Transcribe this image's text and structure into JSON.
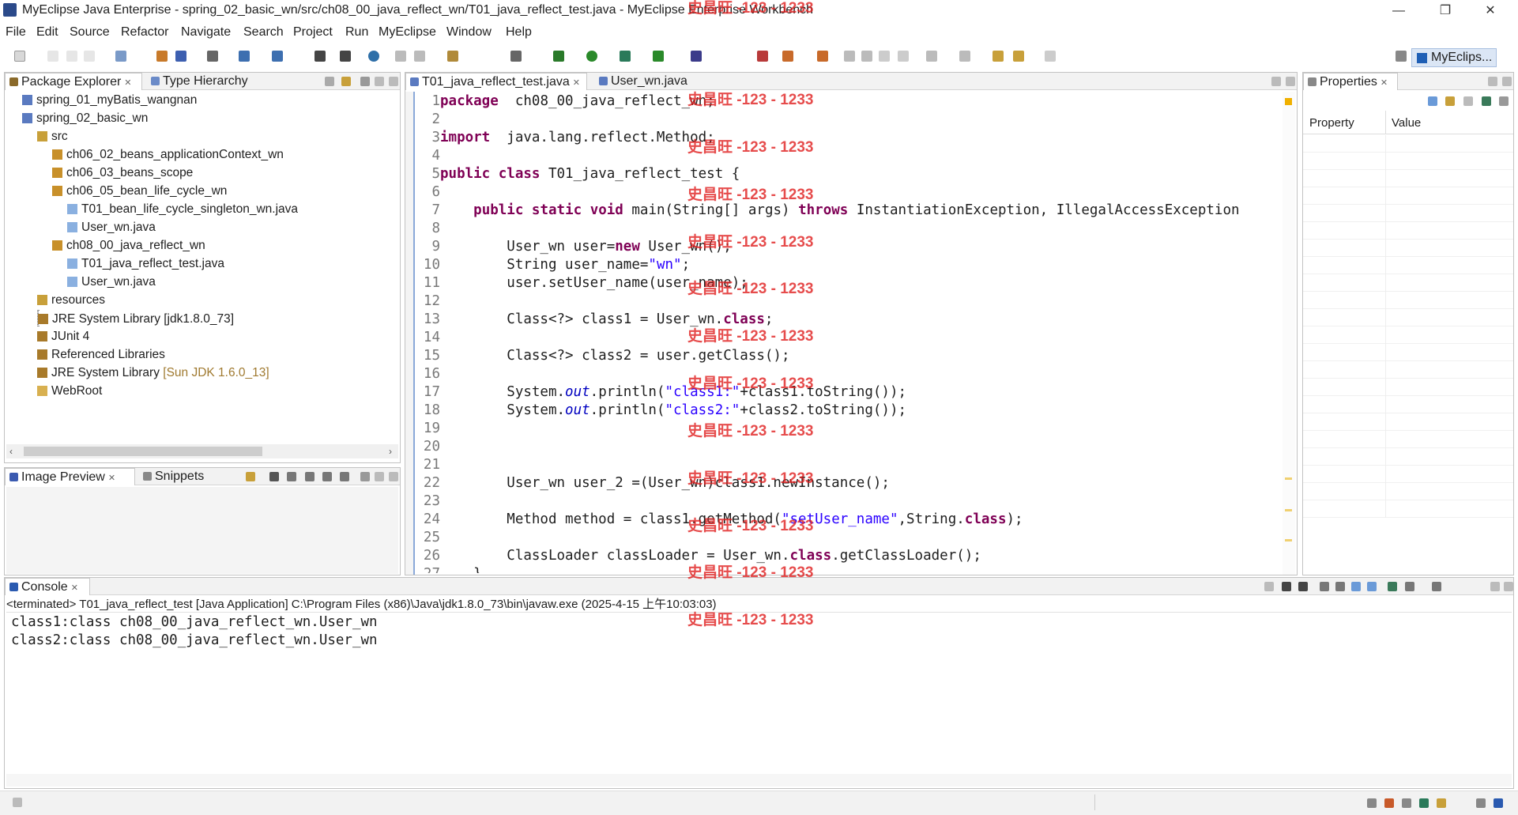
{
  "window": {
    "title": "MyEclipse Java Enterprise - spring_02_basic_wn/src/ch08_00_java_reflect_wn/T01_java_reflect_test.java - MyEclipse Enterprise Workbench",
    "minimize": "—",
    "restore": "❐",
    "close": "✕"
  },
  "menu": [
    "File",
    "Edit",
    "Source",
    "Refactor",
    "Navigate",
    "Search",
    "Project",
    "Run",
    "MyEclipse",
    "Window",
    "Help"
  ],
  "perspective": "MyEclips...",
  "package_explorer": {
    "tab": "Package Explorer",
    "tab2": "Type Hierarchy",
    "items": [
      {
        "label": "spring_01_myBatis_wangnan",
        "suffix": "",
        "icon": "project-icon",
        "indent": 0
      },
      {
        "label": "spring_02_basic_wn",
        "suffix": "",
        "icon": "project-icon",
        "indent": 0
      },
      {
        "label": "src",
        "suffix": "",
        "icon": "source-folder-icon",
        "indent": 1
      },
      {
        "label": "ch06_02_beans_applicationContext_wn",
        "suffix": "",
        "icon": "package-icon",
        "indent": 2
      },
      {
        "label": "ch06_03_beans_scope",
        "suffix": "",
        "icon": "package-icon",
        "indent": 2
      },
      {
        "label": "ch06_05_bean_life_cycle_wn",
        "suffix": "",
        "icon": "package-icon",
        "indent": 2
      },
      {
        "label": "T01_bean_life_cycle_singleton_wn.java",
        "suffix": "",
        "icon": "java-file-icon",
        "indent": 3
      },
      {
        "label": "User_wn.java",
        "suffix": "",
        "icon": "java-file-icon",
        "indent": 3
      },
      {
        "label": "ch08_00_java_reflect_wn",
        "suffix": "",
        "icon": "package-icon",
        "indent": 2
      },
      {
        "label": "T01_java_reflect_test.java",
        "suffix": "",
        "icon": "java-file-icon",
        "indent": 3
      },
      {
        "label": "User_wn.java",
        "suffix": "",
        "icon": "java-file-icon",
        "indent": 3
      },
      {
        "label": "resources",
        "suffix": "",
        "icon": "source-folder-icon",
        "indent": 1
      },
      {
        "label": "JRE System Library [jdk1.8.0_73]",
        "suffix": "",
        "icon": "library-icon",
        "indent": 1
      },
      {
        "label": "JUnit 4",
        "suffix": "",
        "icon": "library-icon",
        "indent": 1
      },
      {
        "label": "Referenced Libraries",
        "suffix": "",
        "icon": "library-icon",
        "indent": 1
      },
      {
        "label": "JRE System Library",
        "suffix": " [Sun JDK 1.6.0_13]",
        "icon": "library-icon",
        "indent": 1
      },
      {
        "label": "WebRoot",
        "suffix": "",
        "icon": "folder-icon",
        "indent": 1
      }
    ]
  },
  "image_preview": {
    "tab": "Image Preview",
    "tab2": "Snippets"
  },
  "editor": {
    "tabs": [
      "T01_java_reflect_test.java",
      "User_wn.java"
    ],
    "lines": [
      [
        [
          "kw",
          "package"
        ],
        [
          "",
          "  ch08_00_java_reflect_wn;"
        ]
      ],
      [],
      [
        [
          "kw",
          "import"
        ],
        [
          "",
          "  java.lang.reflect.Method;"
        ]
      ],
      [],
      [
        [
          "kw",
          "public"
        ],
        [
          "",
          " "
        ],
        [
          "kw",
          "class"
        ],
        [
          "",
          " T01_java_reflect_test {"
        ]
      ],
      [],
      [
        [
          "",
          "    "
        ],
        [
          "kw",
          "public"
        ],
        [
          "",
          " "
        ],
        [
          "kw",
          "static"
        ],
        [
          "",
          " "
        ],
        [
          "kw",
          "void"
        ],
        [
          "",
          " main(String[] args) "
        ],
        [
          "kw",
          "throws"
        ],
        [
          "",
          " InstantiationException, IllegalAccessException"
        ]
      ],
      [],
      [
        [
          "",
          "        User_wn user="
        ],
        [
          "kw",
          "new"
        ],
        [
          "",
          " User_wn();"
        ]
      ],
      [
        [
          "",
          "        String user_name="
        ],
        [
          "str",
          "\"wn\""
        ],
        [
          "",
          ";"
        ]
      ],
      [
        [
          "",
          "        user.setUser_name(user_name);"
        ]
      ],
      [],
      [
        [
          "",
          "        Class<?> class1 = User_wn."
        ],
        [
          "kw",
          "class"
        ],
        [
          "",
          ";"
        ]
      ],
      [],
      [
        [
          "",
          "        Class<?> class2 = user.getClass();"
        ]
      ],
      [],
      [
        [
          "",
          "        System."
        ],
        [
          "fld",
          "out"
        ],
        [
          "",
          ".println("
        ],
        [
          "str",
          "\"class1:\""
        ],
        [
          "",
          "+class1.toString());"
        ]
      ],
      [
        [
          "",
          "        System."
        ],
        [
          "fld",
          "out"
        ],
        [
          "",
          ".println("
        ],
        [
          "str",
          "\"class2:\""
        ],
        [
          "",
          "+class2.toString());"
        ]
      ],
      [],
      [],
      [],
      [
        [
          "",
          "        User_wn user_2 =(User_wn)class1.newInstance();"
        ]
      ],
      [],
      [
        [
          "",
          "        Method method = class1.getMethod("
        ],
        [
          "str",
          "\"setUser_name\""
        ],
        [
          "",
          ",String."
        ],
        [
          "kw",
          "class"
        ],
        [
          "",
          ");"
        ]
      ],
      [],
      [
        [
          "",
          "        ClassLoader classLoader = User_wn."
        ],
        [
          "kw",
          "class"
        ],
        [
          "",
          ".getClassLoader();"
        ]
      ],
      [
        [
          "",
          "    }"
        ]
      ]
    ]
  },
  "properties": {
    "tab": "Properties",
    "col1": "Property",
    "col2": "Value"
  },
  "console": {
    "tab": "Console",
    "header": "<terminated> T01_java_reflect_test [Java Application] C:\\Program Files (x86)\\Java\\jdk1.8.0_73\\bin\\javaw.exe (2025-4-15 上午10:03:03)",
    "lines": [
      "class1:class ch08_00_java_reflect_wn.User_wn",
      "class2:class ch08_00_java_reflect_wn.User_wn"
    ]
  },
  "watermark": "史昌旺 -123 - 1233",
  "colors": {
    "keyword": "#7f0055",
    "string": "#2a00ff",
    "field": "#0000c0",
    "watermark": "#e02020"
  }
}
